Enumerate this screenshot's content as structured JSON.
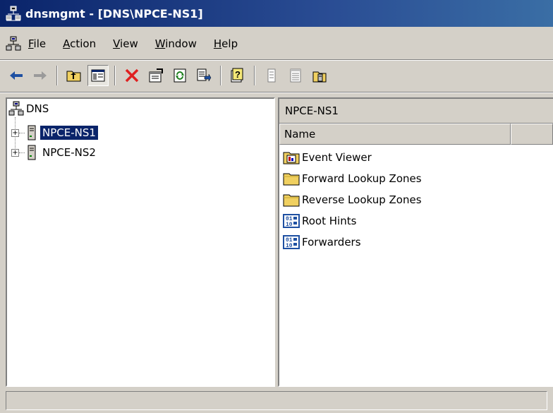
{
  "window": {
    "title": "dnsmgmt - [DNS\\NPCE-NS1]"
  },
  "menubar": {
    "items": [
      {
        "underline": "F",
        "rest": "ile"
      },
      {
        "underline": "A",
        "rest": "ction"
      },
      {
        "underline": "V",
        "rest": "iew"
      },
      {
        "underline": "W",
        "rest": "indow"
      },
      {
        "underline": "H",
        "rest": "elp"
      }
    ]
  },
  "toolbar": {
    "buttons": [
      "back-arrow-icon",
      "forward-arrow-icon",
      "up-one-level-icon",
      "show-hide-console-tree-icon",
      "delete-icon",
      "properties-icon",
      "refresh-icon",
      "export-list-icon",
      "help-icon",
      "list-view-icon",
      "detail-view-icon",
      "server-folder-icon"
    ]
  },
  "tree": {
    "root": {
      "label": "DNS"
    },
    "servers": [
      {
        "label": "NPCE-NS1",
        "selected": true
      },
      {
        "label": "NPCE-NS2",
        "selected": false
      }
    ]
  },
  "details": {
    "header": "NPCE-NS1",
    "columns": [
      "Name"
    ],
    "items": [
      {
        "label": "Event Viewer",
        "icon": "event-viewer-icon"
      },
      {
        "label": "Forward Lookup Zones",
        "icon": "folder-icon"
      },
      {
        "label": "Reverse Lookup Zones",
        "icon": "folder-icon"
      },
      {
        "label": "Root Hints",
        "icon": "records-icon"
      },
      {
        "label": "Forwarders",
        "icon": "records-icon"
      }
    ]
  },
  "status": {
    "text": ""
  },
  "colors": {
    "title_bar": "#0a246a",
    "selection": "#0a246a",
    "face": "#d4d0c8"
  }
}
